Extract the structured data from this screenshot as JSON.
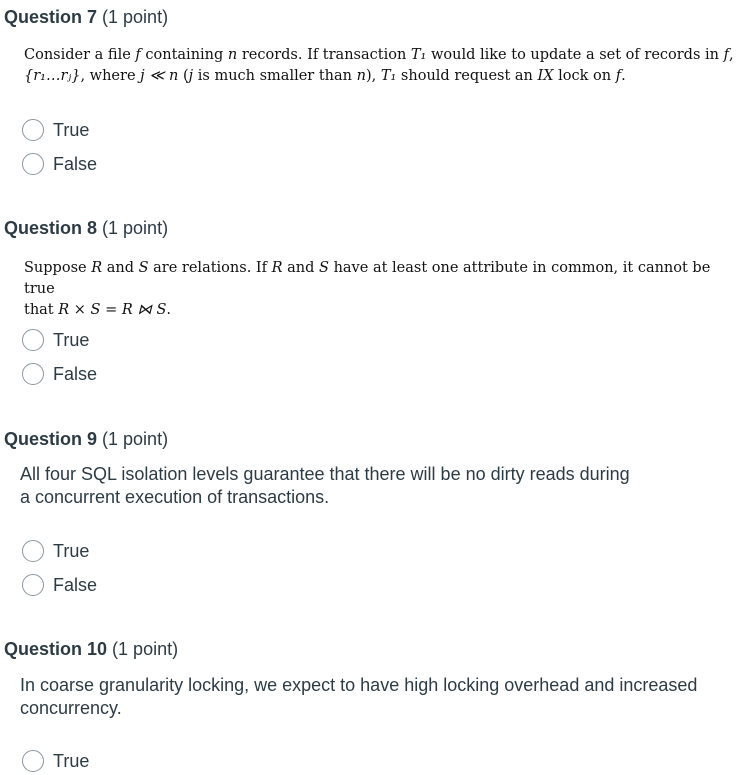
{
  "questions": [
    {
      "number_label": "Question 7",
      "points": "(1 point)",
      "text": [
        "Consider a file ",
        "f",
        " containing ",
        "n",
        " records. If transaction ",
        "T₁",
        " would like to update a set of records in ",
        "f",
        ",",
        "{r₁…rⱼ}",
        ", where ",
        "j ≪ n",
        " (",
        "j",
        " is much smaller than ",
        "n",
        "), ",
        "T₁",
        " should request an ",
        "IX",
        " lock on ",
        "f",
        "."
      ],
      "options": [
        "True",
        "False"
      ]
    },
    {
      "number_label": "Question 8",
      "points": "(1 point)",
      "text": [
        "Suppose ",
        "R",
        " and ",
        "S",
        " are relations. If ",
        "R",
        " and ",
        "S",
        " have at least one attribute in common, it cannot be true",
        "that ",
        "R × S = R ⋈ S",
        "."
      ],
      "options": [
        "True",
        "False"
      ]
    },
    {
      "number_label": "Question 9",
      "points": "(1 point)",
      "text": [
        "All four SQL isolation levels guarantee that there will be no dirty reads during",
        "a concurrent execution of transactions."
      ],
      "options": [
        "True",
        "False"
      ]
    },
    {
      "number_label": "Question 10",
      "points": "(1 point)",
      "text": [
        "In coarse granularity locking, we expect to have high locking overhead and increased",
        "concurrency."
      ],
      "options": [
        "True"
      ]
    }
  ]
}
